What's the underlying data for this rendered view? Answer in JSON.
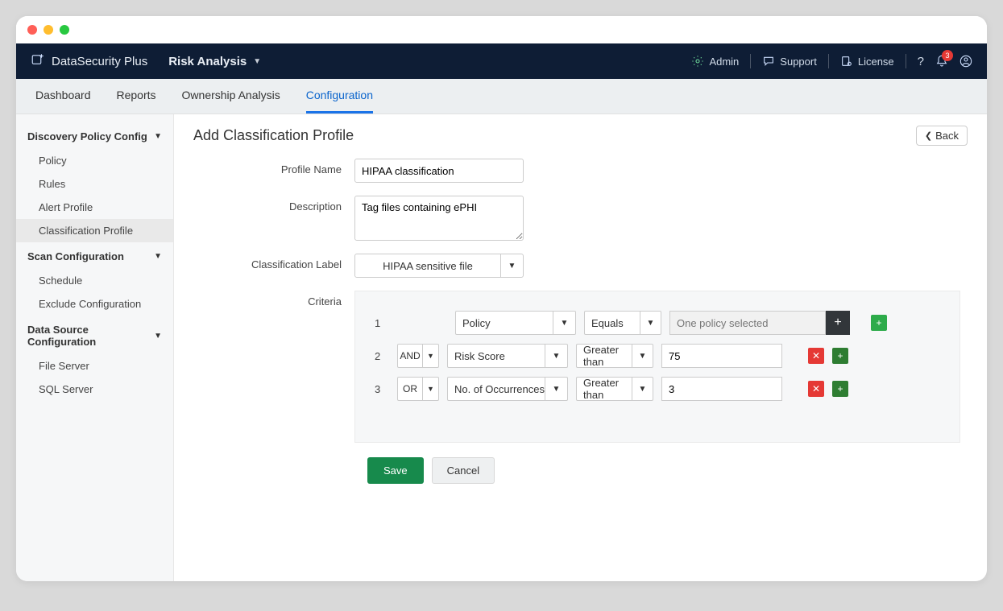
{
  "brand": "DataSecurity Plus",
  "module": "Risk Analysis",
  "top": {
    "admin": "Admin",
    "support": "Support",
    "license": "License",
    "notif_count": "3"
  },
  "tabs": [
    "Dashboard",
    "Reports",
    "Ownership Analysis",
    "Configuration"
  ],
  "active_tab": "Configuration",
  "sidebar": {
    "groups": [
      {
        "title": "Discovery Policy Config",
        "items": [
          "Policy",
          "Rules",
          "Alert Profile",
          "Classification Profile"
        ],
        "active": "Classification Profile"
      },
      {
        "title": "Scan Configuration",
        "items": [
          "Schedule",
          "Exclude Configuration"
        ]
      },
      {
        "title": "Data Source Configuration",
        "items": [
          "File Server",
          "SQL Server"
        ]
      }
    ]
  },
  "page": {
    "title": "Add Classification Profile",
    "back": "Back",
    "labels": {
      "profile_name": "Profile Name",
      "description": "Description",
      "classification_label": "Classification Label",
      "criteria": "Criteria"
    },
    "values": {
      "profile_name": "HIPAA classification",
      "description": "Tag files containing ePHI",
      "classification_label": "HIPAA sensitive file"
    },
    "criteria": [
      {
        "n": "1",
        "logic": null,
        "field": "Policy",
        "op": "Equals",
        "value": "One policy selected",
        "readonly": true,
        "dark_plus": true
      },
      {
        "n": "2",
        "logic": "AND",
        "field": "Risk Score",
        "op": "Greater than",
        "value": "75"
      },
      {
        "n": "3",
        "logic": "OR",
        "field": "No. of Occurrences",
        "op": "Greater than",
        "value": "3"
      }
    ],
    "buttons": {
      "save": "Save",
      "cancel": "Cancel"
    }
  }
}
